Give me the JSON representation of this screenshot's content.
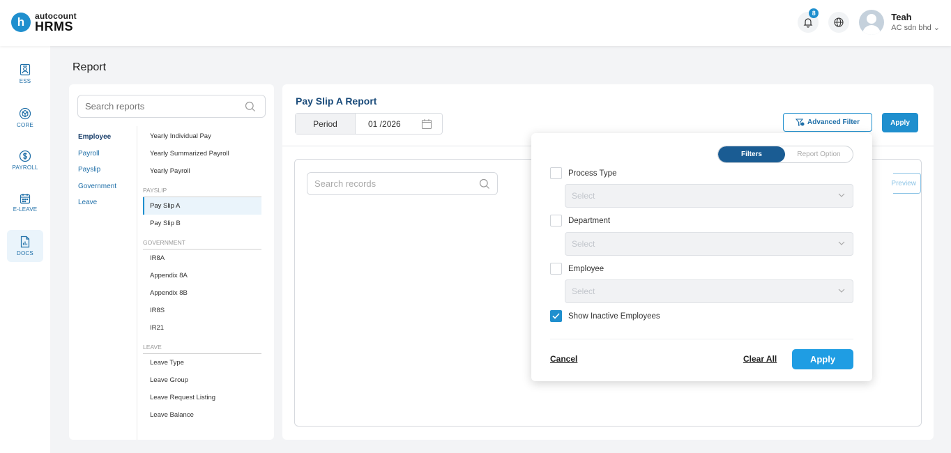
{
  "header": {
    "logo_small": "autocount",
    "logo_big": "HRMS",
    "logo_letter": "h",
    "notification_count": "8",
    "user_name": "Teah",
    "user_org": "AC sdn bhd"
  },
  "sidebar": {
    "items": [
      {
        "label": "ESS",
        "icon": "ess-icon"
      },
      {
        "label": "CORE",
        "icon": "core-icon"
      },
      {
        "label": "PAYROLL",
        "icon": "payroll-icon"
      },
      {
        "label": "E-LEAVE",
        "icon": "calendar-icon"
      },
      {
        "label": "DOCS",
        "icon": "docs-icon"
      }
    ],
    "active": "DOCS"
  },
  "page": {
    "title": "Report"
  },
  "report_nav": {
    "search_placeholder": "Search reports",
    "categories": [
      "Employee",
      "Payroll",
      "Payslip",
      "Government",
      "Leave"
    ],
    "active_category": "Employee",
    "employee_reports": [
      "Yearly Individual Pay",
      "Yearly Summarized Payroll",
      "Yearly Payroll"
    ],
    "payslip_header": "PAYSLIP",
    "payslip_reports": [
      "Pay Slip A",
      "Pay Slip B"
    ],
    "government_header": "GOVERNMENT",
    "government_reports": [
      "IR8A",
      "Appendix 8A",
      "Appendix 8B",
      "IR8S",
      "IR21"
    ],
    "leave_header": "LEAVE",
    "leave_reports": [
      "Leave Type",
      "Leave Group",
      "Leave Request Listing",
      "Leave Balance"
    ],
    "selected_report": "Pay Slip A"
  },
  "report": {
    "title": "Pay Slip A Report",
    "period_label": "Period",
    "period_value": "01 /2026",
    "advanced_filter_label": "Advanced Filter",
    "apply_label": "Apply",
    "search_records_placeholder": "Search records",
    "preview_label": "Preview"
  },
  "filter_popover": {
    "tab_filters": "Filters",
    "tab_report_option": "Report Option",
    "process_type_label": "Process Type",
    "process_type_value": "Select",
    "department_label": "Department",
    "department_value": "Select",
    "employee_label": "Employee",
    "employee_value": "Select",
    "show_inactive_label": "Show Inactive Employees",
    "show_inactive_checked": true,
    "cancel_label": "Cancel",
    "clear_all_label": "Clear All",
    "apply_label": "Apply"
  },
  "colors": {
    "primary": "#1f8fce",
    "dark_blue": "#1a5c93",
    "title_blue": "#1a4b7a"
  }
}
